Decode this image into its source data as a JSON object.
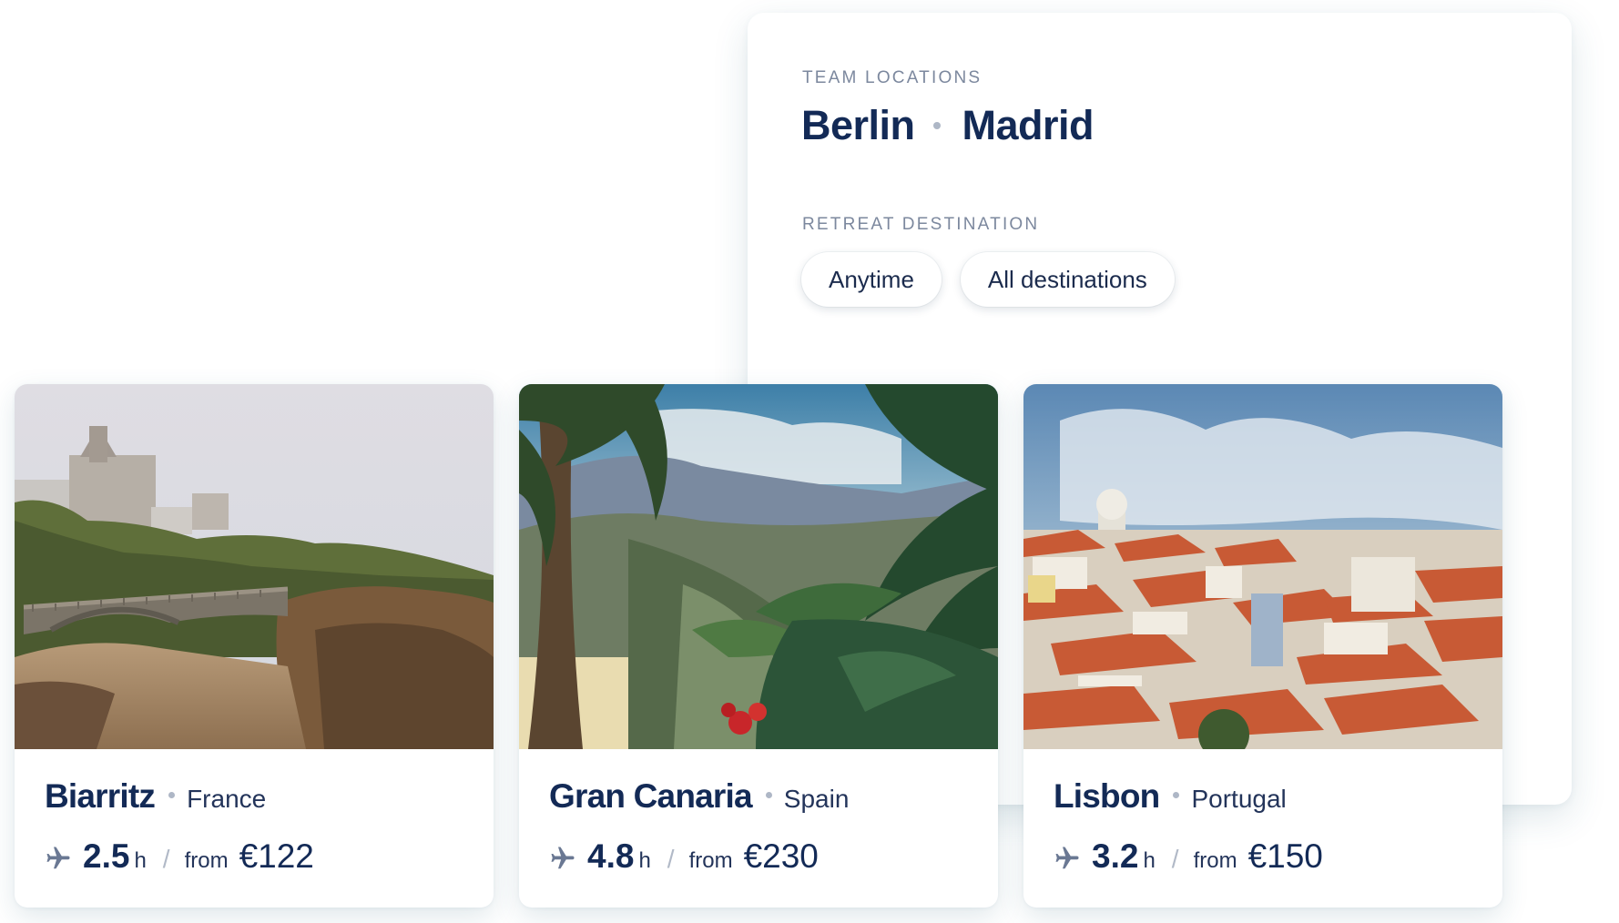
{
  "panel": {
    "team_label": "TEAM LOCATIONS",
    "cities": [
      "Berlin",
      "Madrid"
    ],
    "retreat_label": "RETREAT DESTINATION",
    "filters": [
      "Anytime",
      "All destinations"
    ]
  },
  "destinations": [
    {
      "name": "Biarritz",
      "country": "France",
      "hours": "2.5",
      "unit": "h",
      "from_label": "from",
      "price": "€122",
      "photo": "biarritz-coast-bridge"
    },
    {
      "name": "Gran Canaria",
      "country": "Spain",
      "hours": "4.8",
      "unit": "h",
      "from_label": "from",
      "price": "€230",
      "photo": "gran-canaria-palm-valley"
    },
    {
      "name": "Lisbon",
      "country": "Portugal",
      "hours": "3.2",
      "unit": "h",
      "from_label": "from",
      "price": "€150",
      "photo": "lisbon-rooftops"
    }
  ],
  "icons": {
    "flight": "plane-icon"
  },
  "colors": {
    "heading": "#132a56",
    "muted": "#7c889e",
    "accent_shadow": "#215c70"
  }
}
